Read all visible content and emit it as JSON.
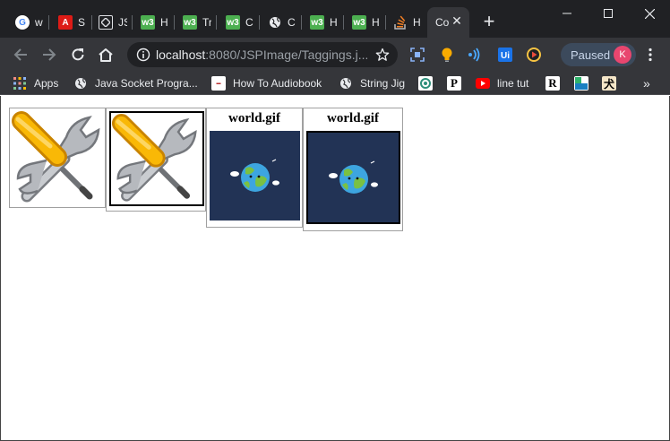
{
  "tabs": [
    {
      "label": "w",
      "icon": "google-icon",
      "color": "#ffffff"
    },
    {
      "label": "S",
      "icon": "angular-icon",
      "color": "#dd1b16"
    },
    {
      "label": "JS",
      "icon": "diamond-icon",
      "color": "#dfe1e5"
    },
    {
      "label": "H",
      "icon": "w3schools-icon",
      "color": "#4caf50"
    },
    {
      "label": "Tr",
      "icon": "w3schools-icon",
      "color": "#4caf50"
    },
    {
      "label": "C",
      "icon": "w3schools-icon",
      "color": "#4caf50"
    },
    {
      "label": "C",
      "icon": "globe-icon",
      "color": "#e8eaed"
    },
    {
      "label": "H",
      "icon": "w3schools-icon",
      "color": "#4caf50"
    },
    {
      "label": "H",
      "icon": "w3schools-icon",
      "color": "#4caf50"
    },
    {
      "label": "H",
      "icon": "stackoverflow-icon",
      "color": "#f48024"
    }
  ],
  "active_tab": {
    "label": "Co",
    "close": "✕"
  },
  "new_tab_label": "+",
  "address": {
    "host": "localhost",
    "path": ":8080/JSPImage/Taggings.j..."
  },
  "profile": {
    "status": "Paused",
    "initial": "K",
    "color": "#e8466f"
  },
  "bookmarks": [
    {
      "label": "Apps",
      "icon": "apps-grid-icon"
    },
    {
      "label": "Java Socket Progra...",
      "icon": "globe-icon"
    },
    {
      "label": "How To Audiobook",
      "icon": "audiobook-icon"
    },
    {
      "label": "String Jig",
      "icon": "globe-icon"
    },
    {
      "label": "",
      "icon": "circle-logo-icon"
    },
    {
      "label": "",
      "icon": "p-logo-icon"
    },
    {
      "label": "line tut",
      "icon": "youtube-icon"
    },
    {
      "label": "",
      "icon": "r-logo-icon"
    },
    {
      "label": "",
      "icon": "blue-square-icon"
    },
    {
      "label": "",
      "icon": "kanji-icon"
    }
  ],
  "bookmarks_overflow": "»",
  "page": {
    "cards": [
      {
        "caption": "",
        "image": "tools-icon",
        "bordered": false
      },
      {
        "caption": "",
        "image": "tools-icon",
        "bordered": true
      },
      {
        "caption": "world.gif",
        "image": "world-icon",
        "bordered": false
      },
      {
        "caption": "world.gif",
        "image": "world-icon",
        "bordered": true
      }
    ]
  }
}
